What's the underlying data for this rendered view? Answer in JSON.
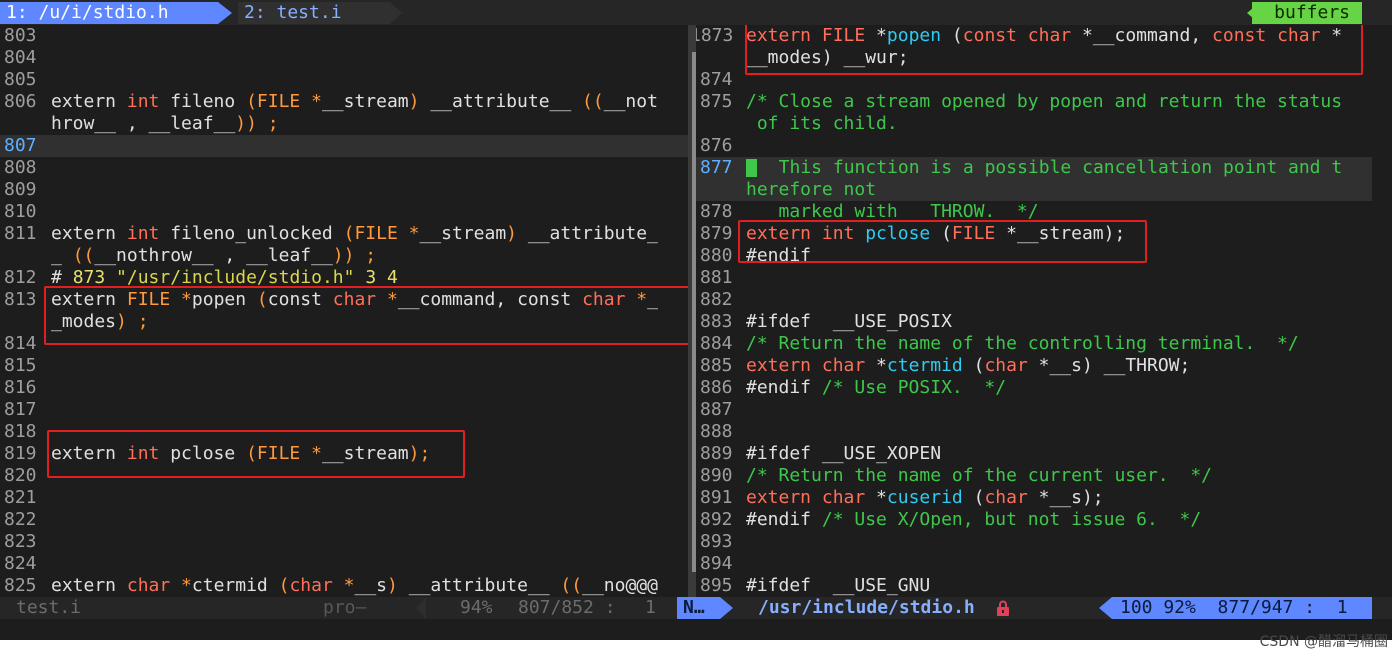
{
  "tabline": {
    "tab1": "1: /u/i/stdio.h",
    "tab2": "2: test.i",
    "buffers": "buffers"
  },
  "left_pane": {
    "rows": [
      {
        "ln": "803",
        "segs": []
      },
      {
        "ln": "804",
        "segs": []
      },
      {
        "ln": "805",
        "segs": []
      },
      {
        "ln": "806",
        "segs": [
          {
            "t": "extern ",
            "c": "k"
          },
          {
            "t": "int",
            "c": "t"
          },
          {
            "t": " fileno ",
            "c": "k"
          },
          {
            "t": "(FILE *",
            "c": "o"
          },
          {
            "t": "__stream",
            "c": "k"
          },
          {
            "t": ")",
            "c": "o"
          },
          {
            "t": " __attribute__ ",
            "c": "k"
          },
          {
            "t": "((",
            "c": "o"
          },
          {
            "t": "__not",
            "c": "k"
          }
        ]
      },
      {
        "ln": "",
        "segs": [
          {
            "t": "hrow__ , __leaf__",
            "c": "k"
          },
          {
            "t": ")) ;",
            "c": "o"
          }
        ]
      },
      {
        "ln": "807",
        "cur": true,
        "segs": []
      },
      {
        "ln": "808",
        "segs": []
      },
      {
        "ln": "809",
        "segs": []
      },
      {
        "ln": "810",
        "segs": []
      },
      {
        "ln": "811",
        "segs": [
          {
            "t": "extern ",
            "c": "k"
          },
          {
            "t": "int",
            "c": "t"
          },
          {
            "t": " fileno_unlocked ",
            "c": "k"
          },
          {
            "t": "(FILE *",
            "c": "o"
          },
          {
            "t": "__stream",
            "c": "k"
          },
          {
            "t": ")",
            "c": "o"
          },
          {
            "t": " __attribute_",
            "c": "k"
          }
        ]
      },
      {
        "ln": "",
        "segs": [
          {
            "t": "_ ",
            "c": "k"
          },
          {
            "t": "((",
            "c": "o"
          },
          {
            "t": "__nothrow__ , __leaf__",
            "c": "k"
          },
          {
            "t": ")) ;",
            "c": "o"
          }
        ]
      },
      {
        "ln": "812",
        "segs": [
          {
            "t": "# ",
            "c": "k"
          },
          {
            "t": "873",
            "c": "n"
          },
          {
            "t": " ",
            "c": "k"
          },
          {
            "t": "\"/usr/include/stdio.h\"",
            "c": "s"
          },
          {
            "t": " ",
            "c": "k"
          },
          {
            "t": "3 4",
            "c": "n"
          }
        ]
      },
      {
        "ln": "813",
        "segs": [
          {
            "t": "extern ",
            "c": "k"
          },
          {
            "t": "FILE *",
            "c": "o"
          },
          {
            "t": "popen ",
            "c": "k"
          },
          {
            "t": "(",
            "c": "o"
          },
          {
            "t": "const ",
            "c": "k"
          },
          {
            "t": "char",
            "c": "t"
          },
          {
            "t": " *",
            "c": "o"
          },
          {
            "t": "__command, ",
            "c": "k"
          },
          {
            "t": "const ",
            "c": "k"
          },
          {
            "t": "char",
            "c": "t"
          },
          {
            "t": " *",
            "c": "o"
          },
          {
            "t": "_",
            "c": "k"
          }
        ]
      },
      {
        "ln": "",
        "segs": [
          {
            "t": "_modes",
            "c": "k"
          },
          {
            "t": ") ;",
            "c": "o"
          }
        ]
      },
      {
        "ln": "814",
        "segs": []
      },
      {
        "ln": "815",
        "segs": []
      },
      {
        "ln": "816",
        "segs": []
      },
      {
        "ln": "817",
        "segs": []
      },
      {
        "ln": "818",
        "segs": []
      },
      {
        "ln": "819",
        "segs": [
          {
            "t": "extern ",
            "c": "k"
          },
          {
            "t": "int",
            "c": "t"
          },
          {
            "t": " pclose ",
            "c": "k"
          },
          {
            "t": "(FILE *",
            "c": "o"
          },
          {
            "t": "__stream",
            "c": "k"
          },
          {
            "t": ");",
            "c": "o"
          }
        ]
      },
      {
        "ln": "820",
        "segs": []
      },
      {
        "ln": "821",
        "segs": []
      },
      {
        "ln": "822",
        "segs": []
      },
      {
        "ln": "823",
        "segs": []
      },
      {
        "ln": "824",
        "segs": []
      },
      {
        "ln": "825",
        "segs": [
          {
            "t": "extern ",
            "c": "k"
          },
          {
            "t": "char",
            "c": "t"
          },
          {
            "t": " *",
            "c": "o"
          },
          {
            "t": "ctermid ",
            "c": "k"
          },
          {
            "t": "(",
            "c": "o"
          },
          {
            "t": "char",
            "c": "t"
          },
          {
            "t": " *",
            "c": "o"
          },
          {
            "t": "__s",
            "c": "k"
          },
          {
            "t": ")",
            "c": "o"
          },
          {
            "t": " __attribute__ ",
            "c": "k"
          },
          {
            "t": "((",
            "c": "o"
          },
          {
            "t": "__no@@@",
            "c": "k"
          }
        ]
      }
    ]
  },
  "right_pane": {
    "rows": [
      {
        "ln": "1873",
        "segs": [
          {
            "t": "extern ",
            "c": "t"
          },
          {
            "t": "FILE ",
            "c": "t"
          },
          {
            "t": "*",
            "c": "p"
          },
          {
            "t": "popen ",
            "c": "f"
          },
          {
            "t": "(",
            "c": "p"
          },
          {
            "t": "const ",
            "c": "t"
          },
          {
            "t": "char ",
            "c": "t"
          },
          {
            "t": "*__command, ",
            "c": "p"
          },
          {
            "t": "const ",
            "c": "t"
          },
          {
            "t": "char ",
            "c": "t"
          },
          {
            "t": "*",
            "c": "p"
          }
        ]
      },
      {
        "ln": "",
        "segs": [
          {
            "t": "__modes) __wur;",
            "c": "p"
          }
        ]
      },
      {
        "ln": "874",
        "segs": []
      },
      {
        "ln": "875",
        "segs": [
          {
            "t": "/* Close a stream opened by popen and return the status",
            "c": "c"
          }
        ]
      },
      {
        "ln": "",
        "segs": [
          {
            "t": " of its child.",
            "c": "c"
          }
        ]
      },
      {
        "ln": "876",
        "segs": []
      },
      {
        "ln": "877",
        "cur": true,
        "cursor": true,
        "segs": [
          {
            "t": "  This function is a possible cancellation point and t",
            "c": "c"
          }
        ]
      },
      {
        "ln": "",
        "segs": [
          {
            "t": "herefore not",
            "c": "c"
          }
        ]
      },
      {
        "ln": "878",
        "segs": [
          {
            "t": "   marked with   THROW.  */",
            "c": "c"
          }
        ]
      },
      {
        "ln": "879",
        "segs": [
          {
            "t": "extern ",
            "c": "t"
          },
          {
            "t": "int ",
            "c": "t"
          },
          {
            "t": "pclose ",
            "c": "f"
          },
          {
            "t": "(",
            "c": "p"
          },
          {
            "t": "FILE ",
            "c": "t"
          },
          {
            "t": "*__stream);",
            "c": "p"
          }
        ]
      },
      {
        "ln": "880",
        "segs": [
          {
            "t": "#endif",
            "c": "p"
          }
        ]
      },
      {
        "ln": "881",
        "segs": []
      },
      {
        "ln": "882",
        "segs": []
      },
      {
        "ln": "883",
        "segs": [
          {
            "t": "#ifdef  __USE_POSIX",
            "c": "p"
          }
        ]
      },
      {
        "ln": "884",
        "segs": [
          {
            "t": "/* Return the name of the controlling terminal.  */",
            "c": "c"
          }
        ]
      },
      {
        "ln": "885",
        "segs": [
          {
            "t": "extern ",
            "c": "t"
          },
          {
            "t": "char ",
            "c": "t"
          },
          {
            "t": "*",
            "c": "p"
          },
          {
            "t": "ctermid ",
            "c": "f"
          },
          {
            "t": "(",
            "c": "p"
          },
          {
            "t": "char ",
            "c": "t"
          },
          {
            "t": "*__s) __THROW;",
            "c": "p"
          }
        ]
      },
      {
        "ln": "886",
        "segs": [
          {
            "t": "#endif ",
            "c": "p"
          },
          {
            "t": "/* Use POSIX.  */",
            "c": "c"
          }
        ]
      },
      {
        "ln": "887",
        "segs": []
      },
      {
        "ln": "888",
        "segs": []
      },
      {
        "ln": "889",
        "segs": [
          {
            "t": "#ifdef __USE_XOPEN",
            "c": "p"
          }
        ]
      },
      {
        "ln": "890",
        "segs": [
          {
            "t": "/* Return the name of the current user.  */",
            "c": "c"
          }
        ]
      },
      {
        "ln": "891",
        "segs": [
          {
            "t": "extern ",
            "c": "t"
          },
          {
            "t": "char ",
            "c": "t"
          },
          {
            "t": "*",
            "c": "p"
          },
          {
            "t": "cuserid ",
            "c": "f"
          },
          {
            "t": "(",
            "c": "p"
          },
          {
            "t": "char ",
            "c": "t"
          },
          {
            "t": "*__s);",
            "c": "p"
          }
        ]
      },
      {
        "ln": "892",
        "segs": [
          {
            "t": "#endif ",
            "c": "p"
          },
          {
            "t": "/* Use X/Open, but not issue 6.  */",
            "c": "c"
          }
        ]
      },
      {
        "ln": "893",
        "segs": []
      },
      {
        "ln": "894",
        "segs": []
      },
      {
        "ln": "895",
        "segs": [
          {
            "t": "#ifdef  __USE_GNU",
            "c": "p"
          }
        ]
      }
    ]
  },
  "statusline": {
    "left_file": "test.i",
    "left_mode": "pro–",
    "left_percent": "94%",
    "left_position": "807/852 :",
    "left_col": "1",
    "mode": "N…",
    "right_file": "/usr/include/stdio.h",
    "right_info": "100 92%  877/947 :  1"
  },
  "watermark": "CSDN @醋溜马桶圈",
  "colors": {
    "background": "#1d1d1d",
    "tab_active": "#5f87ff",
    "buffers": "#66d444",
    "highlight_box": "#e02020",
    "comment": "#3ec74b"
  }
}
